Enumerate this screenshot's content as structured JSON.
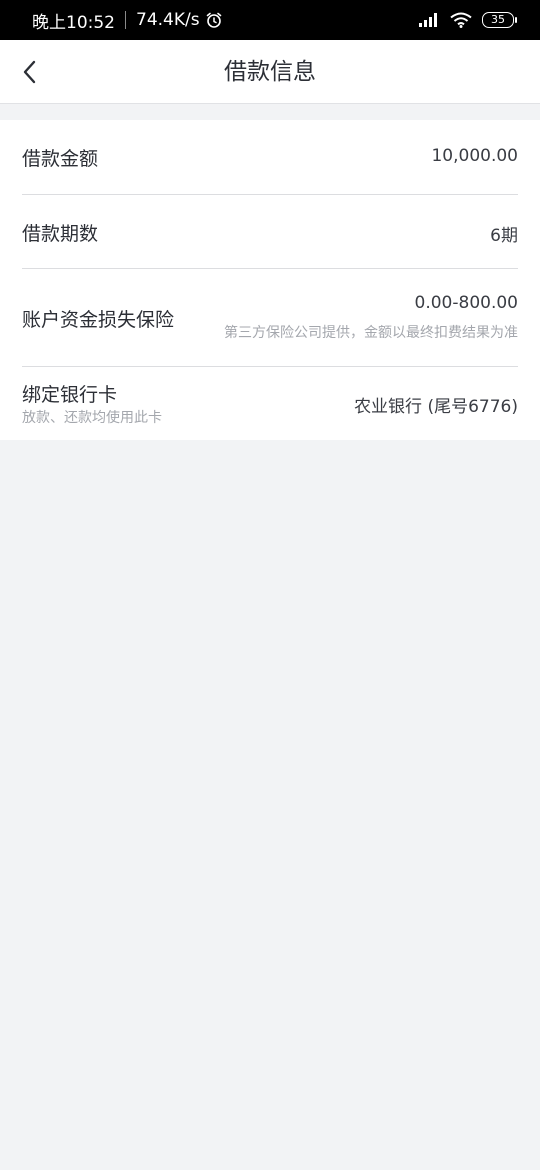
{
  "status_bar": {
    "time": "晚上10:52",
    "speed": "74.4K/s",
    "battery": "35",
    "icons": [
      "alarm-icon",
      "signal-icon",
      "wifi-icon",
      "battery-icon"
    ]
  },
  "nav": {
    "back_icon": "chevron-left-icon",
    "title": "借款信息"
  },
  "details": {
    "amount": {
      "label": "借款金额",
      "value": "10,000.00"
    },
    "periods": {
      "label": "借款期数",
      "value": "6期"
    },
    "insurance": {
      "label": "账户资金损失保险",
      "value": "0.00-800.00",
      "note": "第三方保险公司提供，金额以最终扣费结果为准"
    },
    "bank_card": {
      "label": "绑定银行卡",
      "sub": "放款、还款均使用此卡",
      "value": "农业银行 (尾号6776)"
    }
  },
  "colors": {
    "page_background": "#f2f3f5",
    "card_background": "#ffffff",
    "primary_text": "#2c2f36",
    "secondary_text": "#a4a7ad",
    "status_bar": "#000000"
  }
}
